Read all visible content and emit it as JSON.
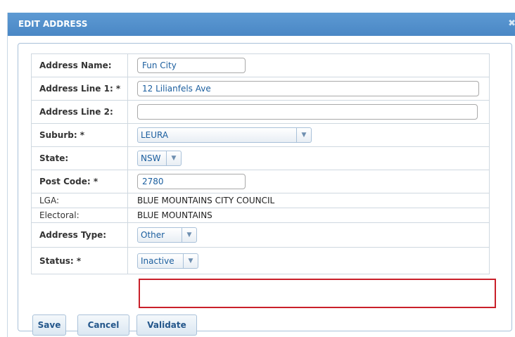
{
  "dialog": {
    "title": "EDIT ADDRESS",
    "close_glyph": "✖"
  },
  "form": {
    "address_name": {
      "label": "Address Name:",
      "value": "Fun City"
    },
    "address_line1": {
      "label": "Address Line 1: *",
      "value": "12 Lilianfels Ave"
    },
    "address_line2": {
      "label": "Address Line 2:",
      "value": ""
    },
    "suburb": {
      "label": "Suburb: *",
      "value": "LEURA"
    },
    "state": {
      "label": "State:",
      "value": "NSW"
    },
    "post_code": {
      "label": "Post Code: *",
      "value": "2780"
    },
    "lga": {
      "label": "LGA:",
      "value": "BLUE MOUNTAINS CITY COUNCIL"
    },
    "electoral": {
      "label": "Electoral:",
      "value": "BLUE MOUNTAINS"
    },
    "address_type": {
      "label": "Address Type:",
      "value": "Other"
    },
    "status": {
      "label": "Status: *",
      "value": "Inactive"
    }
  },
  "buttons": {
    "save": "Save",
    "cancel": "Cancel",
    "validate": "Validate"
  },
  "icons": {
    "dropdown": "chevron-down-icon",
    "close": "close-icon"
  },
  "colors": {
    "title_bar": "#4a87c5",
    "highlight": "#c9202a",
    "value_text": "#1b5e9e"
  }
}
